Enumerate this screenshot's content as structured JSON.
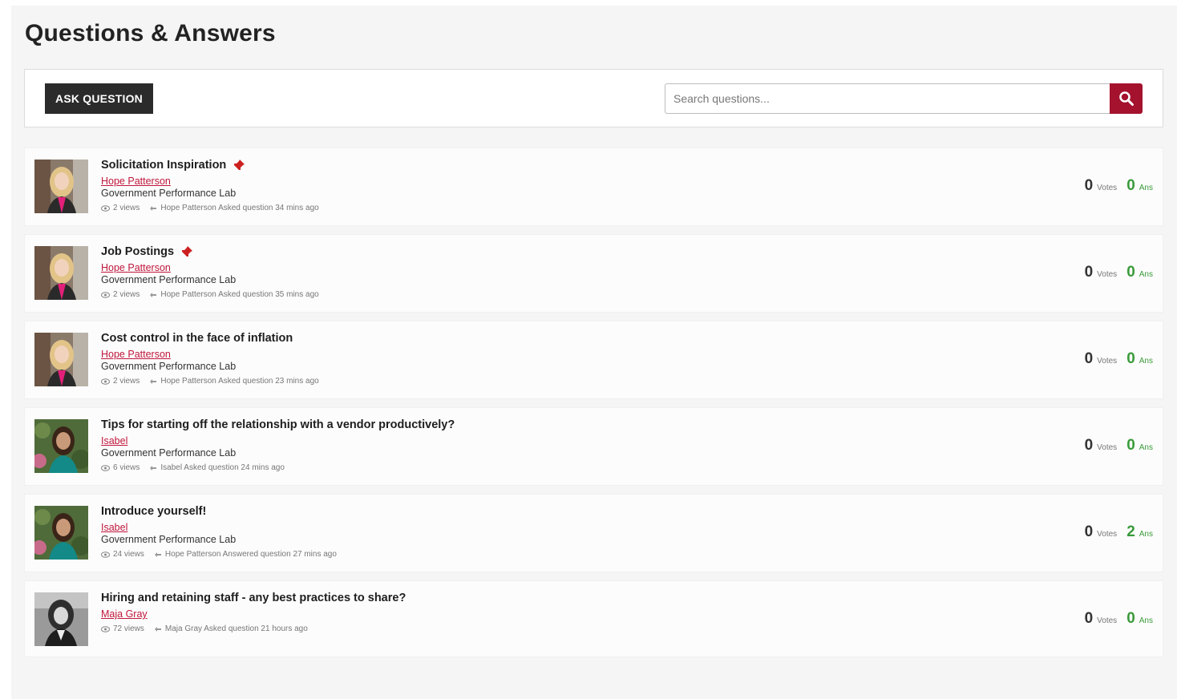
{
  "page": {
    "title": "Questions & Answers"
  },
  "toolbar": {
    "ask_label": "ASK QUESTION",
    "search_placeholder": "Search questions..."
  },
  "colors": {
    "accent": "#a4122e",
    "link": "#c0173c",
    "answers": "#3a9a3a",
    "button_dark": "#2b2b2b"
  },
  "questions": [
    {
      "title": "Solicitation Inspiration",
      "pinned": true,
      "author": "Hope Patterson",
      "group": "Government Performance Lab",
      "views": "2 views",
      "activity": "Hope Patterson Asked question 34 mins ago",
      "votes": "0",
      "votes_label": "Votes",
      "answers": "0",
      "answers_label": "Ans",
      "avatar": "woman-blonde"
    },
    {
      "title": "Job Postings",
      "pinned": true,
      "author": "Hope Patterson",
      "group": "Government Performance Lab",
      "views": "2 views",
      "activity": "Hope Patterson Asked question 35 mins ago",
      "votes": "0",
      "votes_label": "Votes",
      "answers": "0",
      "answers_label": "Ans",
      "avatar": "woman-blonde"
    },
    {
      "title": "Cost control in the face of inflation",
      "pinned": false,
      "author": "Hope Patterson",
      "group": "Government Performance Lab",
      "views": "2 views",
      "activity": "Hope Patterson Asked question 23 mins ago",
      "votes": "0",
      "votes_label": "Votes",
      "answers": "0",
      "answers_label": "Ans",
      "avatar": "woman-blonde"
    },
    {
      "title": "Tips for starting off the relationship with a vendor productively?",
      "pinned": false,
      "author": "Isabel",
      "group": "Government Performance Lab",
      "views": "6 views",
      "activity": "Isabel Asked question 24 mins ago",
      "votes": "0",
      "votes_label": "Votes",
      "answers": "0",
      "answers_label": "Ans",
      "avatar": "woman-brunette"
    },
    {
      "title": "Introduce yourself!",
      "pinned": false,
      "author": "Isabel",
      "group": "Government Performance Lab",
      "views": "24 views",
      "activity": "Hope Patterson Answered question 27 mins ago",
      "votes": "0",
      "votes_label": "Votes",
      "answers": "2",
      "answers_label": "Ans",
      "avatar": "woman-brunette"
    },
    {
      "title": "Hiring and retaining staff - any best practices to share?",
      "pinned": false,
      "author": "Maja Gray",
      "group": "",
      "views": "72 views",
      "activity": "Maja Gray Asked question 21 hours ago",
      "votes": "0",
      "votes_label": "Votes",
      "answers": "0",
      "answers_label": "Ans",
      "avatar": "woman-bw"
    }
  ]
}
